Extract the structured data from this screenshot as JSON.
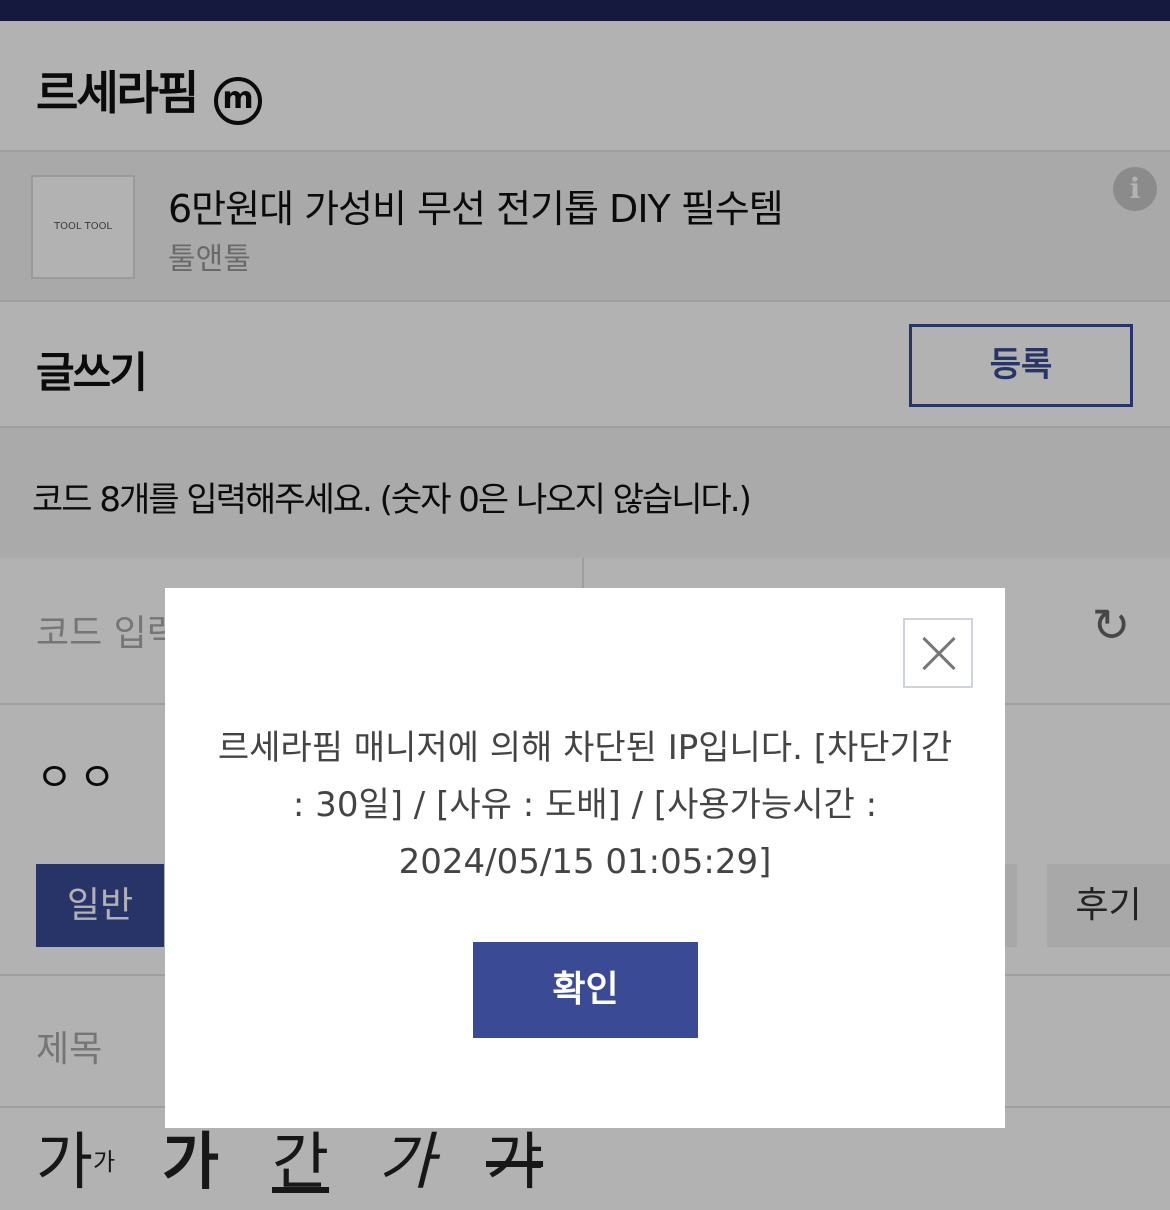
{
  "gallery": {
    "title": "르세라핌",
    "badge": "m"
  },
  "post": {
    "thumbnail_text": "TOOL TOOL",
    "title": "6만원대 가성비 무선 전기톱 DIY 필수템",
    "author": "툴앤툴",
    "info_icon": "i"
  },
  "write": {
    "label": "글쓰기",
    "submit_label": "등록"
  },
  "code": {
    "notice": "코드 8개를 입력해주세요. (숫자 0은 나오지 않습니다.)",
    "input_placeholder": "코드 입력",
    "refresh_icon": "↻"
  },
  "nickname": {
    "value": "ㅇㅇ"
  },
  "categories": [
    {
      "label": "일반"
    },
    {
      "label": "후기"
    }
  ],
  "subject": {
    "placeholder": "제목"
  },
  "editor": {
    "size_label": "가",
    "size_sup": "가",
    "bold_label": "가",
    "underline_label": "간",
    "italic_label": "가",
    "strike_label": "갸"
  },
  "modal": {
    "message_line1": "르세라핌 매니저에 의해 차단된 IP입니다. [차단기간",
    "message_line2": ": 30일] / [사유 : 도배] / [사용가능시간 :",
    "message_line3": "2024/05/15 01:05:29]",
    "confirm_label": "확인",
    "close_icon": "close-icon"
  },
  "colors": {
    "brand_navy": "#1f2458",
    "primary": "#3a4a95"
  }
}
